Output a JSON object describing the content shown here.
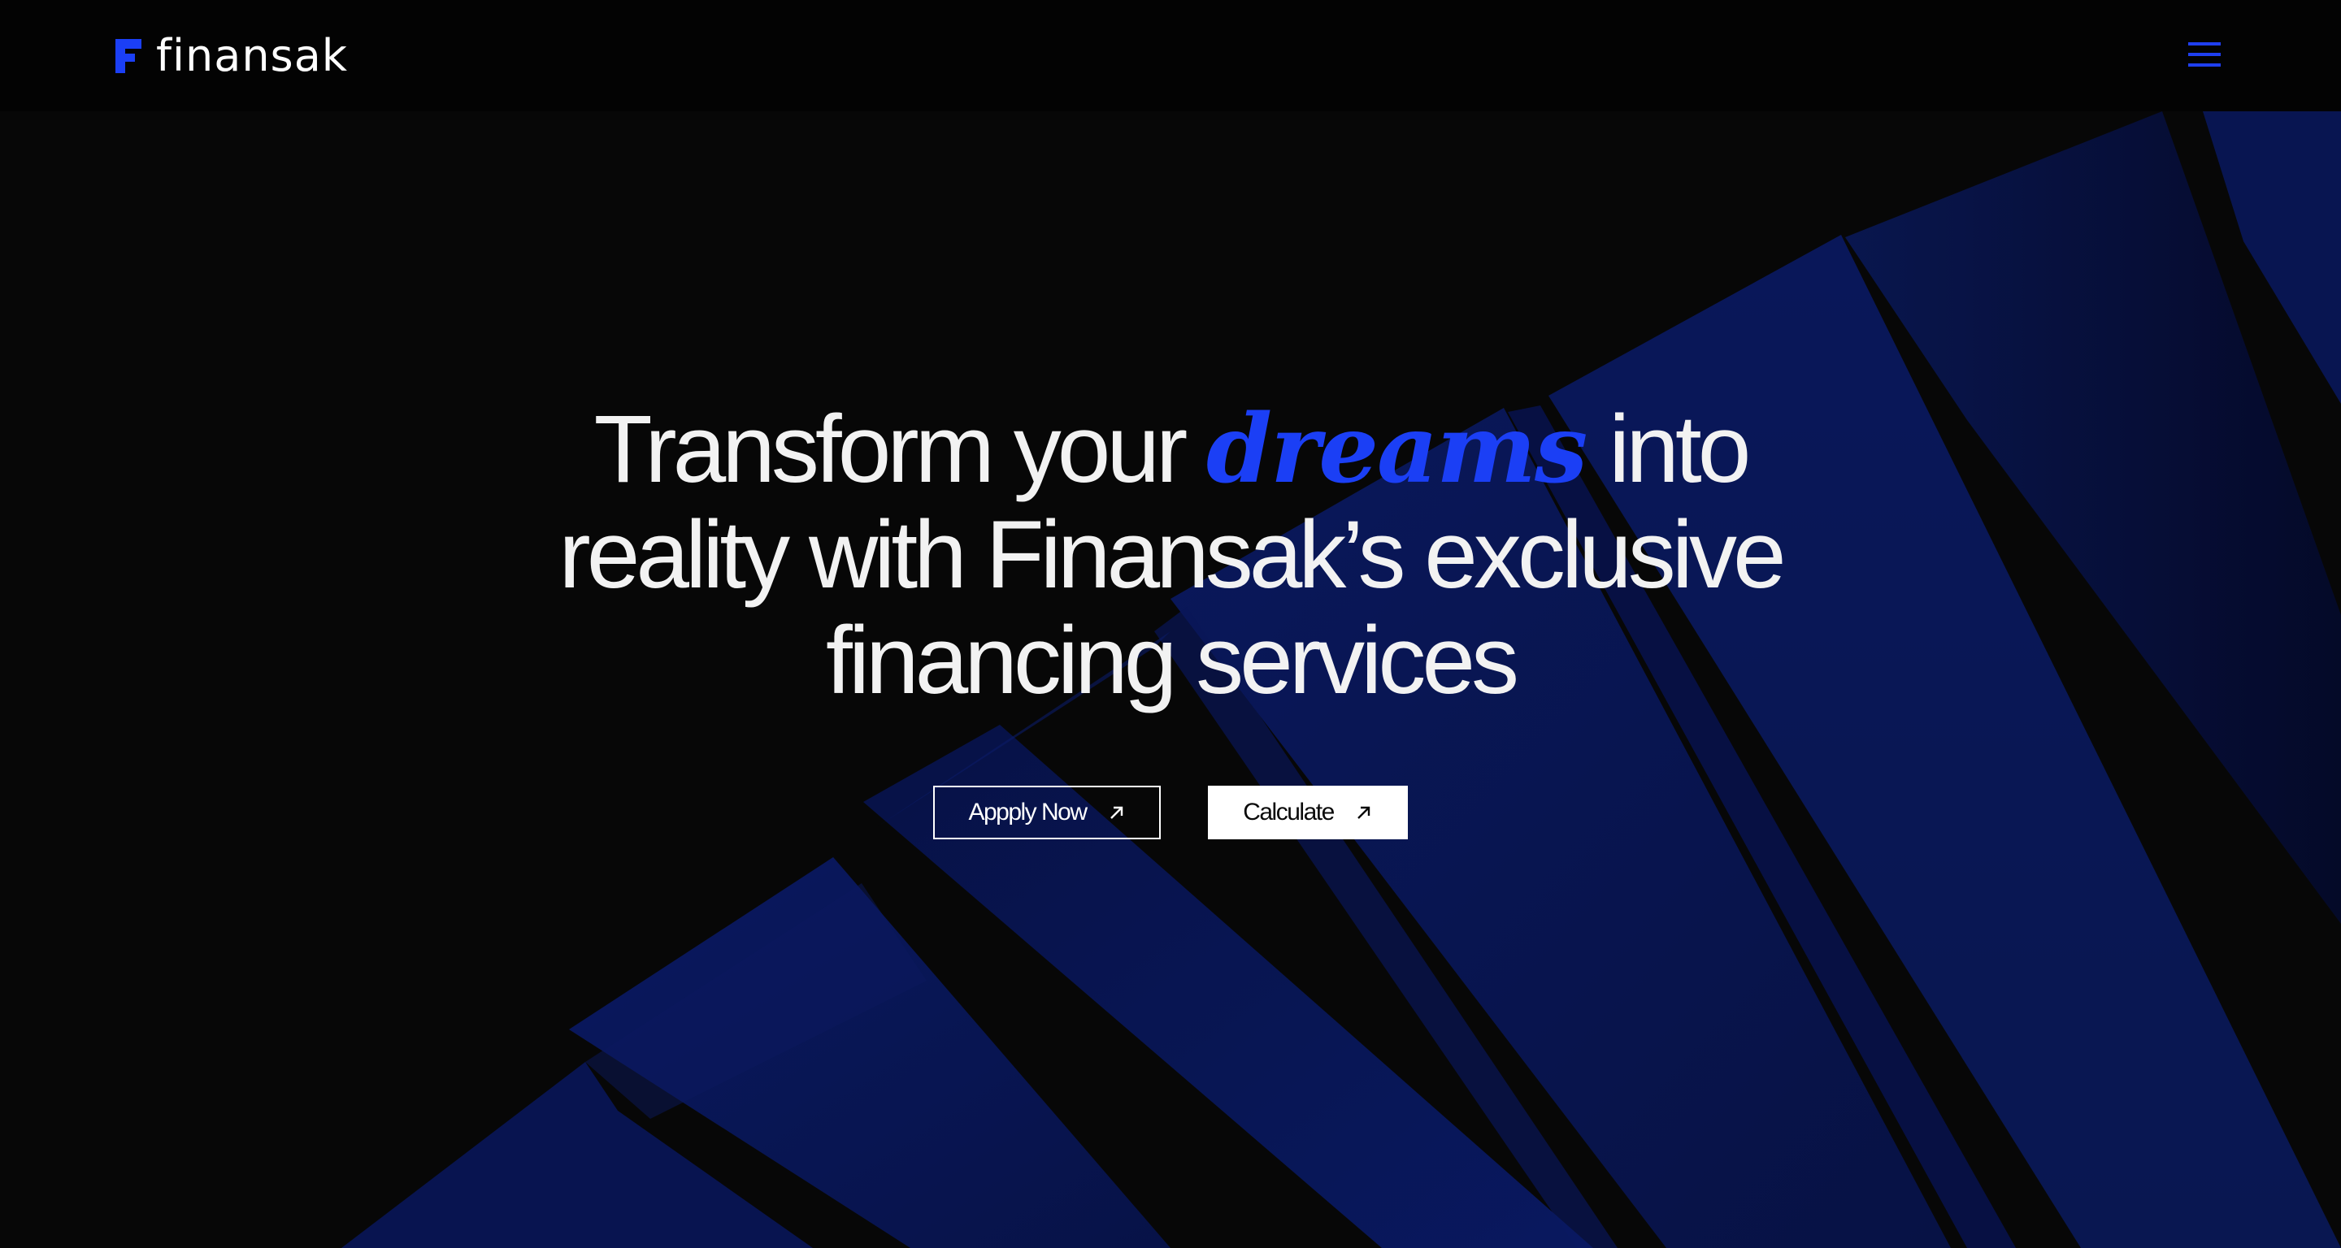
{
  "brand": {
    "name": "finansak",
    "accent_color": "#1b3ff5"
  },
  "nav": {
    "menu_icon": "hamburger-menu-icon"
  },
  "hero": {
    "line1_pre": "Transform your ",
    "line1_accent": "dreams",
    "line1_post": " into",
    "line2": "reality with Finansak’s exclusive",
    "line3": "financing services"
  },
  "cta": {
    "apply_label": "Appply Now",
    "calculate_label": "Calculate",
    "arrow_icon": "arrow-up-right-icon"
  }
}
